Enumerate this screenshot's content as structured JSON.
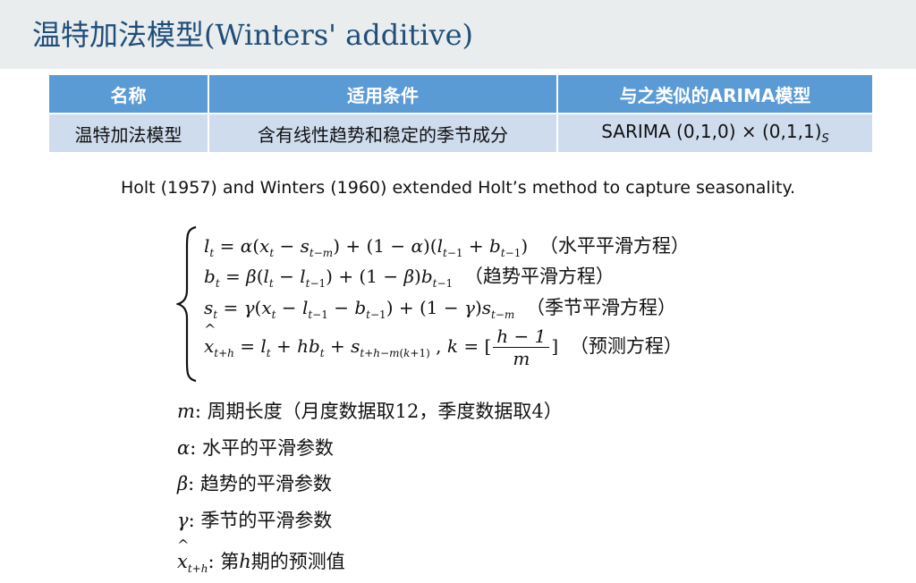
{
  "title": "温特加法模型(Winters' additive)",
  "table": {
    "headers": [
      "名称",
      "适用条件",
      "与之类似的ARIMA模型"
    ],
    "row": {
      "name": "温特加法模型",
      "condition": "含有线性趋势和稳定的季节成分",
      "arima": "SARIMA (0,1,0) × (0,1,1)",
      "arima_sub": "S"
    }
  },
  "note": "Holt (1957) and Winters (1960) extended Holt’s method to capture seasonality.",
  "equations": {
    "level_label": "（水平平滑方程）",
    "trend_label": "（趋势平滑方程）",
    "season_label": "（季节平滑方程）",
    "forecast_label": "（预测方程）"
  },
  "definitions": {
    "m": ": 周期长度（月度数据取12，季度数据取4）",
    "alpha": ": 水平的平滑参数",
    "beta": ": 趋势的平滑参数",
    "gamma": ": 季节的平滑参数",
    "xhat_prefix": ": 第",
    "xhat_suffix": "期的预测值"
  }
}
